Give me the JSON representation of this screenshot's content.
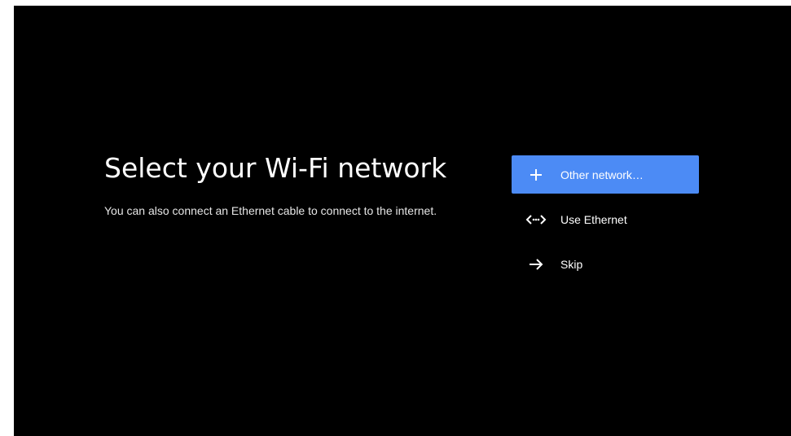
{
  "setup": {
    "title": "Select your Wi-Fi network",
    "subtitle": "You can also connect an Ethernet cable to connect to the internet."
  },
  "options": [
    {
      "label": "Other network…",
      "icon": "plus-icon",
      "selected": true
    },
    {
      "label": "Use Ethernet",
      "icon": "ethernet-icon",
      "selected": false
    },
    {
      "label": "Skip",
      "icon": "arrow-right-icon",
      "selected": false
    }
  ],
  "colors": {
    "background": "#000000",
    "highlight": "#4c8bf5",
    "text": "#ffffff"
  }
}
